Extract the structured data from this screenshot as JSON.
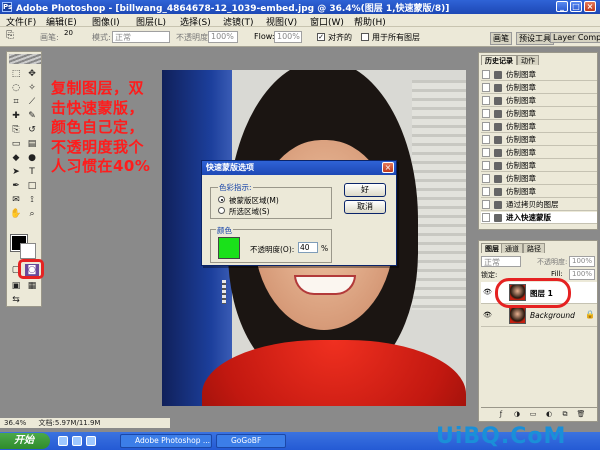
{
  "window": {
    "title": "Adobe Photoshop - [billwang_4864678-12_1039-embed.jpg @ 36.4%(图层 1,快速蒙版/8)]"
  },
  "menu": [
    "文件(F)",
    "编辑(E)",
    "图像(I)",
    "图层(L)",
    "选择(S)",
    "滤镜(T)",
    "视图(V)",
    "窗口(W)",
    "帮助(H)"
  ],
  "options_bar": {
    "brush_label": "画笔:",
    "brush_size": "20",
    "mode_label": "模式:",
    "mode_value": "正常",
    "opacity_label": "不透明度:",
    "opacity_value": "100%",
    "flow_label": "Flow:",
    "flow_value": "100%",
    "aligned_label": "对齐的",
    "all_layers_label": "用于所有图层",
    "panel_tabs": [
      "画笔",
      "预设工具",
      "Layer Comps"
    ]
  },
  "annotation": {
    "lines": [
      "复制图层，双",
      "击快速蒙版，",
      "颜色自己定，",
      "不透明度我个",
      "人习惯在40%"
    ],
    "color": "#ff1c1c"
  },
  "dialog": {
    "title": "快速蒙版选项",
    "color_indicates_label": "色彩指示:",
    "masked_areas_label": "被蒙版区域(M)",
    "selected_areas_label": "所选区域(S)",
    "color_label": "颜色",
    "opacity_label": "不透明度(O):",
    "opacity_value": "40",
    "percent": "%",
    "ok_label": "好",
    "cancel_label": "取消",
    "color_swatch": "#1ae11a"
  },
  "history_panel": {
    "tabs": [
      "历史记录",
      "动作"
    ],
    "items": [
      "仿制图章",
      "仿制图章",
      "仿制图章",
      "仿制图章",
      "仿制图章",
      "仿制图章",
      "仿制图章",
      "仿制图章",
      "仿制图章",
      "仿制图章",
      "通过拷贝的图层",
      "进入快速蒙版"
    ],
    "selected_index": 11
  },
  "layers_panel": {
    "tabs": [
      "图层",
      "通道",
      "路径"
    ],
    "blend_mode": "正常",
    "opacity_label": "不透明度:",
    "opacity_value": "100%",
    "lock_label": "锁定:",
    "fill_label": "Fill:",
    "fill_value": "100%",
    "layers": [
      {
        "name": "图层 1",
        "selected": true
      },
      {
        "name": "Background",
        "selected": false
      }
    ]
  },
  "status_bar": {
    "text": "36.4%",
    "doc_info": "文档:5.97M/11.9M"
  },
  "taskbar": {
    "start_label": "开始",
    "items": [
      "Adobe Photoshop ...",
      "GoGoBF"
    ]
  },
  "watermark": "UiBQ.CoM",
  "accent_highlight_color": "#e52222"
}
